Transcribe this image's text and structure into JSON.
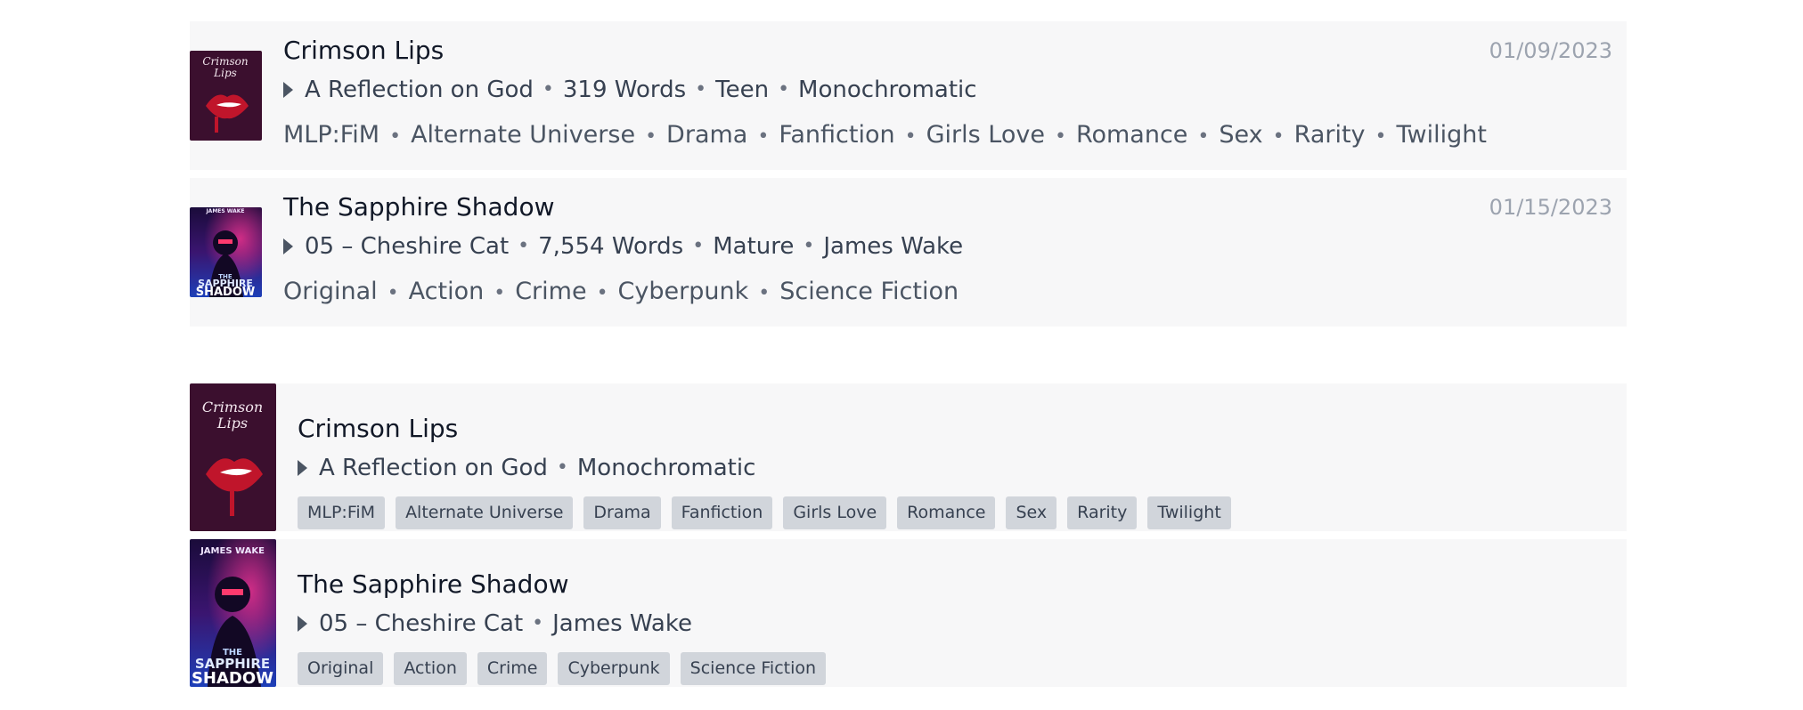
{
  "list_detailed": [
    {
      "title": "Crimson Lips",
      "date": "01/09/2023",
      "chapter": "A Reflection on God",
      "words": "319 Words",
      "rating": "Teen",
      "author": "Monochromatic",
      "tags": [
        "MLP:FiM",
        "Alternate Universe",
        "Drama",
        "Fanfiction",
        "Girls Love",
        "Romance",
        "Sex",
        "Rarity",
        "Twilight"
      ],
      "cover": {
        "title_top": "Crimson",
        "title_bottom": "Lips",
        "bg": "#3b0f2e",
        "lips": "#c0152b"
      }
    },
    {
      "title": "The Sapphire Shadow",
      "date": "01/15/2023",
      "chapter": "05 – Cheshire Cat",
      "words": "7,554 Words",
      "rating": "Mature",
      "author": "James Wake",
      "tags": [
        "Original",
        "Action",
        "Crime",
        "Cyberpunk",
        "Science Fiction"
      ],
      "cover": {
        "author_label": "JAMES WAKE",
        "title_small": "THE",
        "title_line1": "SAPPHIRE",
        "title_line2": "SHADOW",
        "bg": "#1b1f6b"
      }
    }
  ],
  "list_compact": [
    {
      "title": "Crimson Lips",
      "chapter": "A Reflection on God",
      "author": "Monochromatic",
      "tags": [
        "MLP:FiM",
        "Alternate Universe",
        "Drama",
        "Fanfiction",
        "Girls Love",
        "Romance",
        "Sex",
        "Rarity",
        "Twilight"
      ]
    },
    {
      "title": "The Sapphire Shadow",
      "chapter": "05 – Cheshire Cat",
      "author": "James Wake",
      "tags": [
        "Original",
        "Action",
        "Crime",
        "Cyberpunk",
        "Science Fiction"
      ]
    }
  ]
}
